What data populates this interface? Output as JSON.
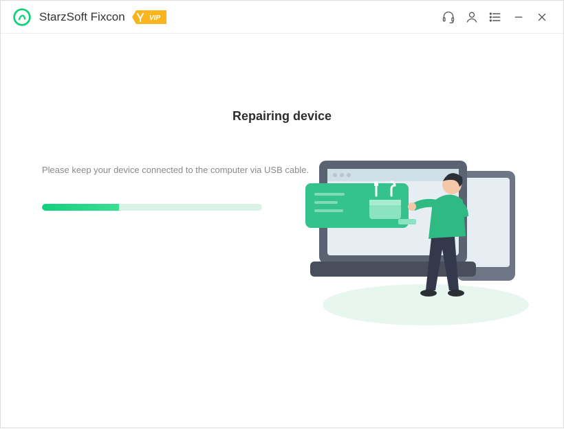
{
  "app": {
    "title": "StarzSoft Fixcon",
    "vip_label": "VIP"
  },
  "main": {
    "heading": "Repairing device",
    "instruction": "Please keep your device connected to the computer via USB cable.",
    "progress_percent": 35
  },
  "colors": {
    "accent": "#11d17e",
    "progress_track": "#daf1e6",
    "vip_bg": "#f9b51e"
  }
}
